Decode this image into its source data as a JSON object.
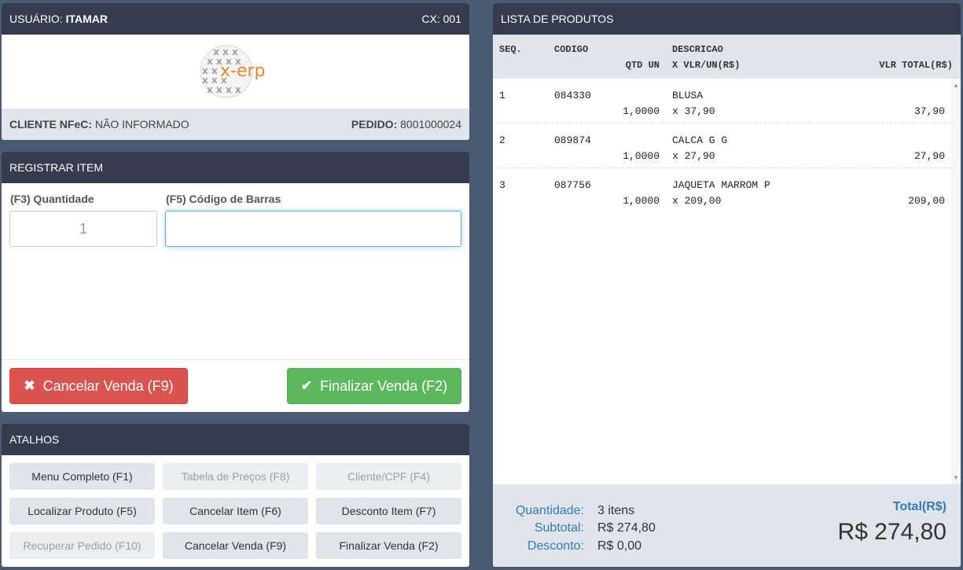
{
  "header": {
    "user_label": "USUÁRIO:",
    "user_name": "ITAMAR",
    "register": "CX: 001",
    "logo_text": "x-erp",
    "client_label": "CLIENTE NFeC:",
    "client_value": "NÃO INFORMADO",
    "order_label": "PEDIDO:",
    "order_value": "8001000024"
  },
  "register": {
    "title": "REGISTRAR ITEM",
    "qty_label": "(F3) Quantidade",
    "qty_value": "1",
    "barcode_label": "(F5) Código de Barras",
    "barcode_value": "",
    "cancel_icon": "✖",
    "cancel_label": "Cancelar Venda (F9)",
    "finish_icon": "✔",
    "finish_label": "Finalizar Venda (F2)"
  },
  "shortcuts": {
    "title": "ATALHOS",
    "items": [
      {
        "label": "Menu Completo (F1)",
        "enabled": true
      },
      {
        "label": "Tabela de Preços (F8)",
        "enabled": false
      },
      {
        "label": "Cliente/CPF (F4)",
        "enabled": false
      },
      {
        "label": "Localizar Produto (F5)",
        "enabled": true
      },
      {
        "label": "Cancelar Item (F6)",
        "enabled": true
      },
      {
        "label": "Desconto Item (F7)",
        "enabled": true
      },
      {
        "label": "Recuperar Pedido (F10)",
        "enabled": false
      },
      {
        "label": "Cancelar Venda (F9)",
        "enabled": true
      },
      {
        "label": "Finalizar Venda (F2)",
        "enabled": true
      }
    ]
  },
  "products": {
    "title": "LISTA DE PRODUTOS",
    "columns": {
      "seq": "SEQ.",
      "code": "CODIGO",
      "desc": "DESCRICAO",
      "qty_un": "QTD UN",
      "unit_price": "X VLR/UN(R$)",
      "total": "VLR TOTAL(R$)"
    },
    "rows": [
      {
        "seq": "1",
        "code": "084330",
        "desc": "BLUSA",
        "qty": "1,0000",
        "unit_price": "x 37,90",
        "total": "37,90"
      },
      {
        "seq": "2",
        "code": "089874",
        "desc": "CALCA G G",
        "qty": "1,0000",
        "unit_price": "x 27,90",
        "total": "27,90"
      },
      {
        "seq": "3",
        "code": "087756",
        "desc": "JAQUETA MARROM P",
        "qty": "1,0000",
        "unit_price": "x 209,00",
        "total": "209,00"
      }
    ]
  },
  "totals": {
    "qty_label": "Quantidade:",
    "qty_value": "3 itens",
    "subtotal_label": "Subtotal:",
    "subtotal_value": "R$ 274,80",
    "discount_label": "Desconto:",
    "discount_value": "R$ 0,00",
    "total_label": "Total(R$)",
    "total_value": "R$ 274,80"
  },
  "colors": {
    "background": "#4a5a70",
    "panel_header": "#353c4d",
    "danger": "#d9534f",
    "success": "#5cb85c",
    "label_blue": "#337ab7",
    "logo_orange": "#e8872a"
  }
}
